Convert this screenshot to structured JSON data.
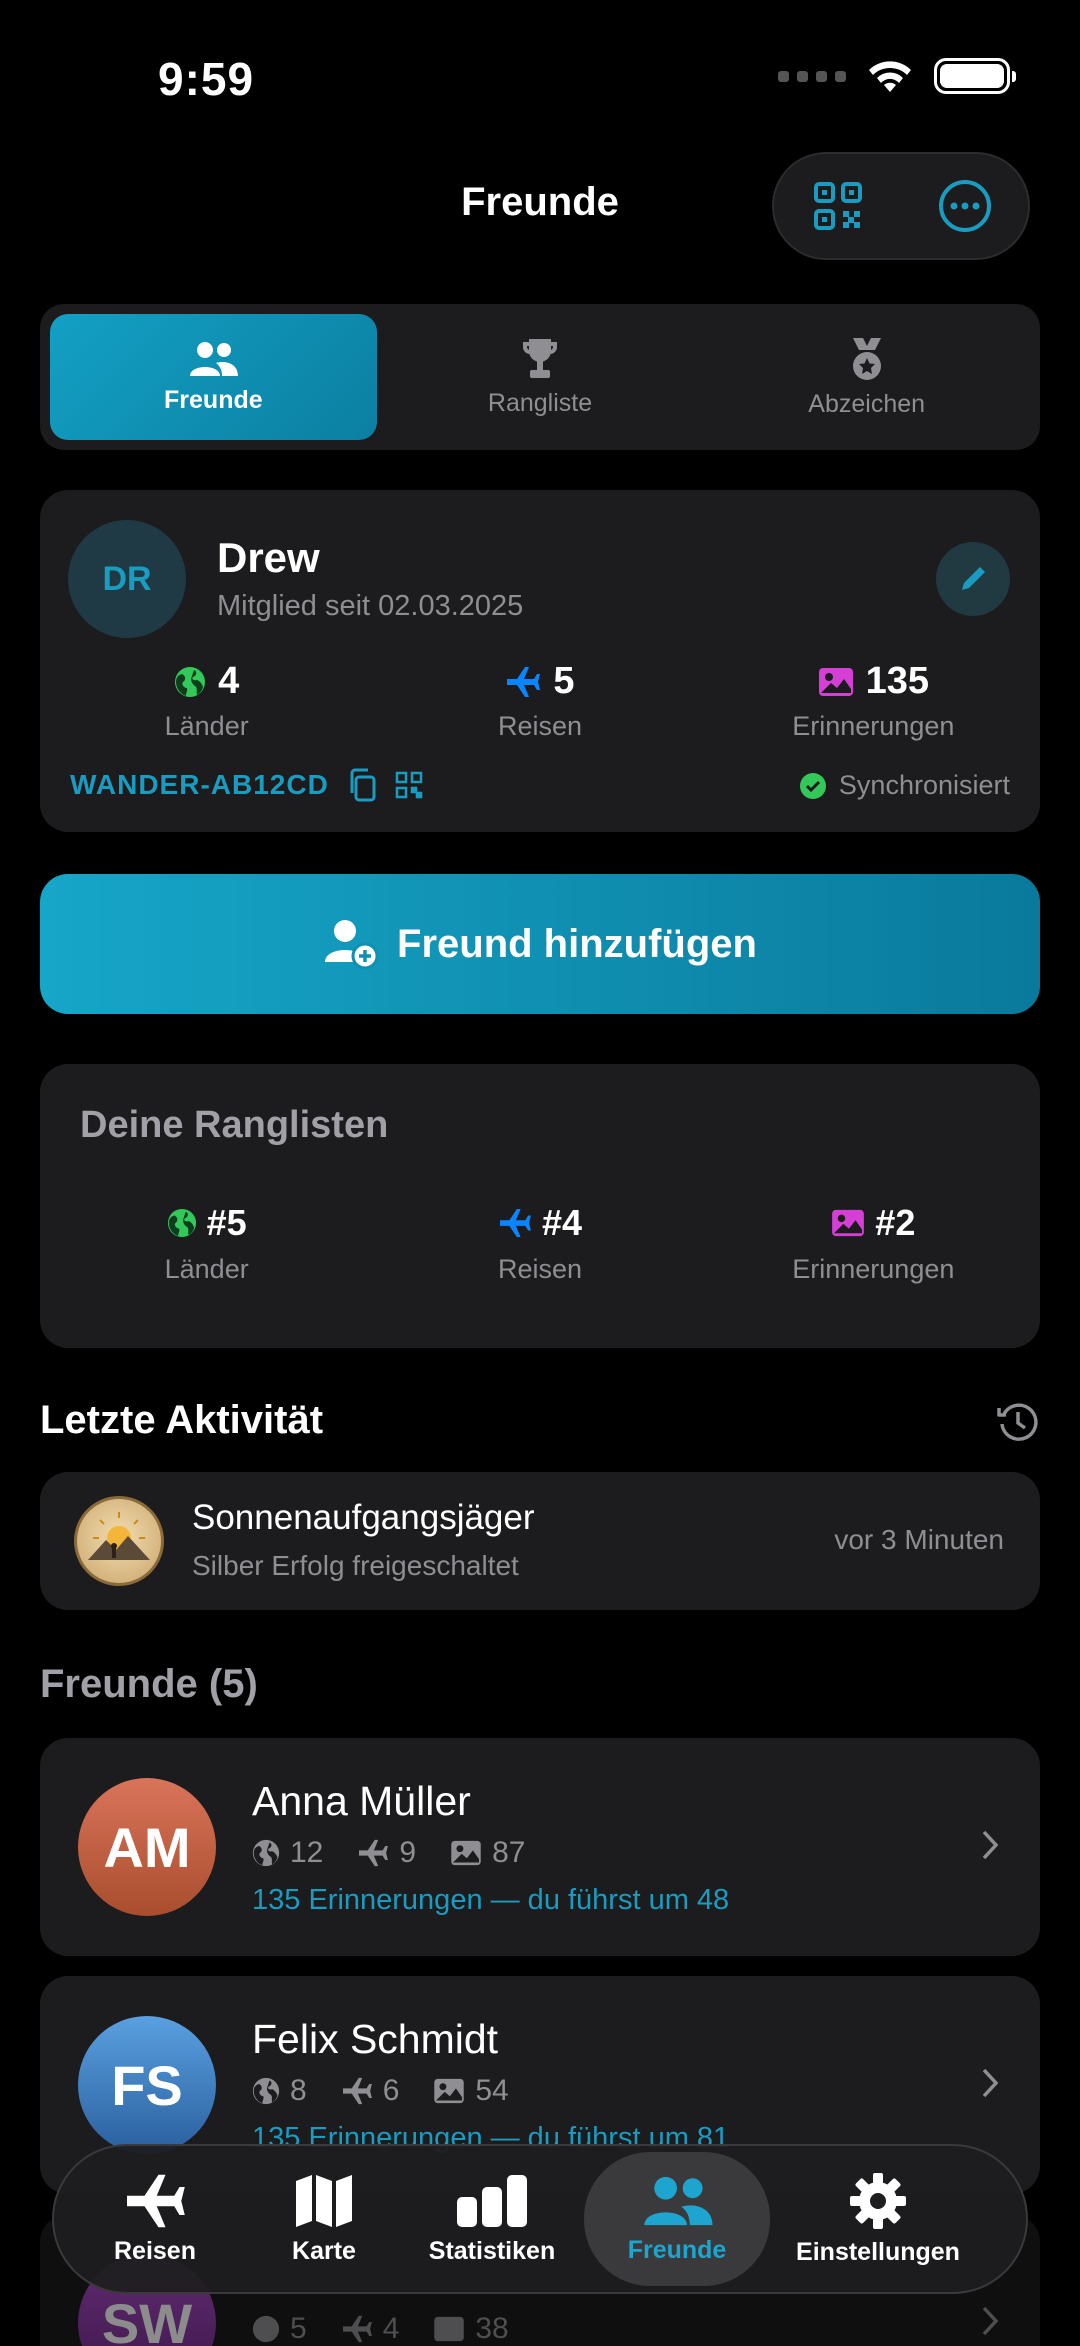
{
  "status": {
    "time": "9:59"
  },
  "header": {
    "title": "Freunde",
    "qr_icon": "qr-code-icon",
    "more_icon": "ellipsis-circle-icon"
  },
  "segments": [
    {
      "label": "Freunde",
      "icon": "people-icon",
      "active": true
    },
    {
      "label": "Rangliste",
      "icon": "trophy-icon",
      "active": false
    },
    {
      "label": "Abzeichen",
      "icon": "medal-icon",
      "active": false
    }
  ],
  "profile": {
    "initials": "DR",
    "name": "Drew",
    "member_since": "Mitglied seit 02.03.2025",
    "stats": [
      {
        "value": "4",
        "label": "Länder",
        "icon": "globe-icon",
        "color": "#34c759"
      },
      {
        "value": "5",
        "label": "Reisen",
        "icon": "airplane-icon",
        "color": "#0a84ff"
      },
      {
        "value": "135",
        "label": "Erinnerungen",
        "icon": "photo-icon",
        "color": "#d63fd6"
      }
    ],
    "code": "WANDER-AB12CD",
    "sync_status": "Synchronisiert"
  },
  "add_friend": {
    "label": "Freund hinzufügen"
  },
  "rankings": {
    "title": "Deine Ranglisten",
    "items": [
      {
        "value": "#5",
        "label": "Länder"
      },
      {
        "value": "#4",
        "label": "Reisen"
      },
      {
        "value": "#2",
        "label": "Erinnerungen"
      }
    ]
  },
  "activity": {
    "title": "Letzte Aktivität",
    "item": {
      "title": "Sonnenaufgangsjäger",
      "subtitle": "Silber Erfolg freigeschaltet",
      "time": "vor 3 Minuten"
    }
  },
  "friends": {
    "title": "Freunde (5)",
    "list": [
      {
        "initials": "AM",
        "name": "Anna Müller",
        "countries": "12",
        "trips": "9",
        "memories": "87",
        "lead": "135 Erinnerungen — du führst um 48",
        "colors": [
          "#d9745a",
          "#a94d2e"
        ]
      },
      {
        "initials": "FS",
        "name": "Felix Schmidt",
        "countries": "8",
        "trips": "6",
        "memories": "54",
        "lead": "135 Erinnerungen — du führst um 81",
        "colors": [
          "#5aa0e0",
          "#2a5f9e"
        ]
      },
      {
        "initials": "SW",
        "name": "",
        "countries": "5",
        "trips": "4",
        "memories": "38",
        "lead": "",
        "colors": [
          "#b34fd0",
          "#6d2a86"
        ]
      }
    ]
  },
  "tabbar": [
    {
      "label": "Reisen",
      "icon": "airplane-icon",
      "active": false
    },
    {
      "label": "Karte",
      "icon": "map-icon",
      "active": false
    },
    {
      "label": "Statistiken",
      "icon": "bar-chart-icon",
      "active": false
    },
    {
      "label": "Freunde",
      "icon": "people-icon",
      "active": true
    },
    {
      "label": "Einstellungen",
      "icon": "gear-icon",
      "active": false
    }
  ]
}
